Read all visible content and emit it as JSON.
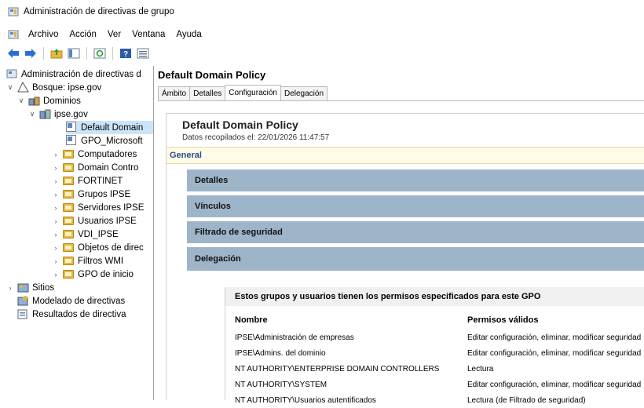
{
  "window": {
    "title": "Administración de directivas de grupo"
  },
  "menu": [
    "Archivo",
    "Acción",
    "Ver",
    "Ventana",
    "Ayuda"
  ],
  "toolbar": [
    "back-icon",
    "forward-icon",
    "up-folder-icon",
    "show-tree-icon",
    "refresh-icon",
    "help-icon",
    "properties-icon"
  ],
  "tree": {
    "root": "Administración de directivas d",
    "forest": "Bosque: ipse.gov",
    "domains": "Dominios",
    "domain": "ipse.gov",
    "items": [
      "Default Domain",
      "GPO_Microsoft",
      "Computadores",
      "Domain Contro",
      "FORTINET",
      "Grupos IPSE",
      "Servidores IPSE",
      "Usuarios IPSE",
      "VDI_IPSE",
      "Objetos de direc",
      "Filtros WMI",
      "GPO de inicio"
    ],
    "sites": "Sitios",
    "modeling": "Modelado de directivas",
    "results": "Resultados de directiva"
  },
  "pane": {
    "title": "Default Domain Policy",
    "tabs": [
      "Ámbito",
      "Detalles",
      "Configuración",
      "Delegación"
    ],
    "active_tab": "Configuración"
  },
  "report": {
    "title": "Default Domain Policy",
    "subtitle": "Datos recopilados el: 22/01/2026 11:47:57",
    "general": "General",
    "sections": [
      "Detalles",
      "Vínculos",
      "Filtrado de seguridad",
      "Delegación"
    ],
    "delegation": {
      "heading": "Estos grupos y usuarios tienen los permisos especificados para este GPO",
      "col_name": "Nombre",
      "col_perm": "Permisos válidos",
      "rows": [
        {
          "name": "IPSE\\Administración de empresas",
          "perm": "Editar configuración, eliminar, modificar seguridad"
        },
        {
          "name": "IPSE\\Admins. del dominio",
          "perm": "Editar configuración, eliminar, modificar seguridad"
        },
        {
          "name": "NT AUTHORITY\\ENTERPRISE DOMAIN CONTROLLERS",
          "perm": "Lectura"
        },
        {
          "name": "NT AUTHORITY\\SYSTEM",
          "perm": "Editar configuración, eliminar, modificar seguridad"
        },
        {
          "name": "NT AUTHORITY\\Usuarios autentificados",
          "perm": "Lectura (de Filtrado de seguridad)"
        }
      ]
    }
  },
  "colors": {
    "section_bg": "#9eb4c8",
    "general_bg": "#fffbe6",
    "selection": "#cce4f7"
  }
}
